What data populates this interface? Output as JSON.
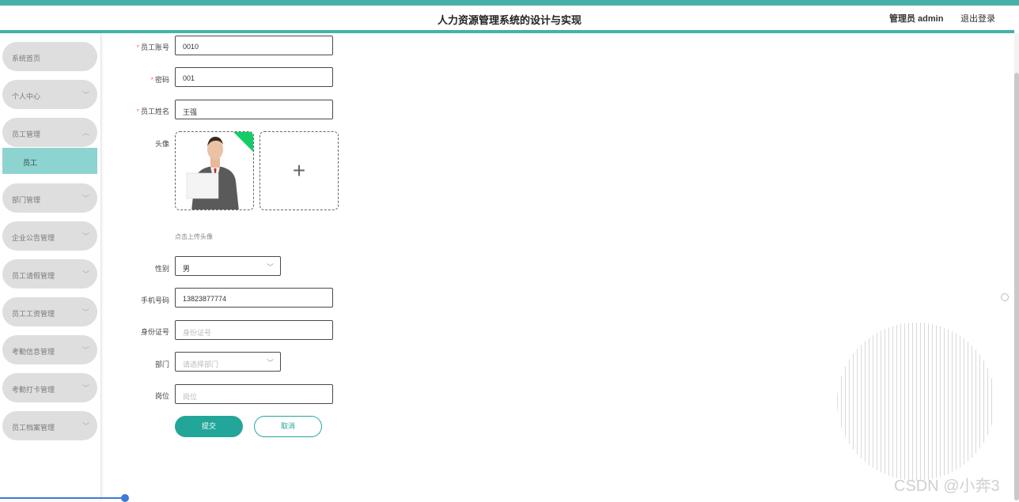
{
  "header": {
    "title": "人力资源管理系统的设计与实现",
    "user_label": "管理员 admin",
    "logout": "退出登录"
  },
  "sidebar": {
    "items": [
      {
        "label": "系统首页",
        "chevron": ""
      },
      {
        "label": "个人中心",
        "chevron": "﹀"
      },
      {
        "label": "员工管理",
        "chevron": "︿"
      },
      {
        "label": "部门管理",
        "chevron": "﹀"
      },
      {
        "label": "企业公告管理",
        "chevron": "﹀"
      },
      {
        "label": "员工请假管理",
        "chevron": "﹀"
      },
      {
        "label": "员工工资管理",
        "chevron": "﹀"
      },
      {
        "label": "考勤信息管理",
        "chevron": "﹀"
      },
      {
        "label": "考勤打卡管理",
        "chevron": "﹀"
      },
      {
        "label": "员工档案管理",
        "chevron": "﹀"
      }
    ],
    "active_subitem": "员工"
  },
  "form": {
    "account": {
      "label": "员工账号",
      "value": "0010"
    },
    "password": {
      "label": "密码",
      "value": "001"
    },
    "name": {
      "label": "员工姓名",
      "value": "王强"
    },
    "avatar": {
      "label": "头像",
      "tip": "点击上传头像",
      "add_icon": "plus-icon"
    },
    "gender": {
      "label": "性别",
      "value": "男"
    },
    "phone": {
      "label": "手机号码",
      "value": "13823877774"
    },
    "id_card": {
      "label": "身份证号",
      "placeholder": "身份证号"
    },
    "department": {
      "label": "部门",
      "placeholder": "请选择部门"
    },
    "position": {
      "label": "岗位",
      "placeholder": "岗位"
    },
    "submit": "提交",
    "cancel": "取消"
  },
  "watermark": "CSDN @小奔3",
  "colors": {
    "accent": "#46b1a7",
    "button": "#23a69a",
    "active_menu": "#8dd3cf",
    "required": "#f56c6c"
  }
}
